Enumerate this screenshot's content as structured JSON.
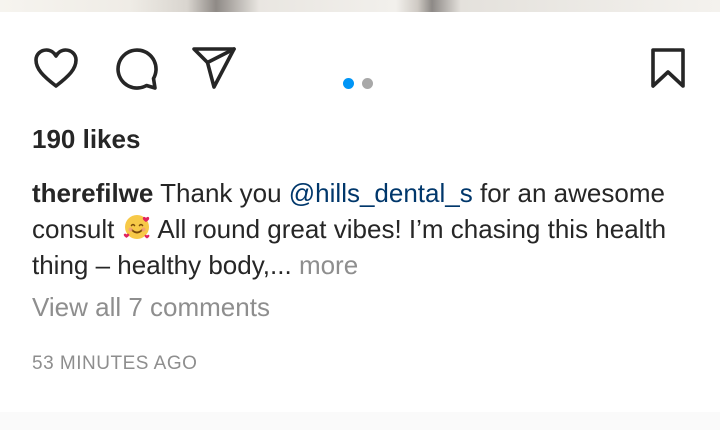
{
  "post": {
    "likes_text": "190 likes",
    "username": "therefilwe",
    "caption_part1": "Thank you",
    "mention": "@hills_dental_s",
    "caption_part2": "for an awesome consult",
    "emoji": "smiling-face-with-hearts",
    "caption_part3": "All round great vibes! I’m chasing this health thing – healthy body,...",
    "more_label": "more",
    "view_comments": "View all 7 comments",
    "timestamp": "53 MINUTES AGO"
  },
  "carousel": {
    "count": 2,
    "active_index": 0
  },
  "icons": [
    "heart-icon",
    "comment-icon",
    "share-icon",
    "bookmark-icon"
  ],
  "colors": {
    "text": "#262626",
    "secondary": "#8e8e8e",
    "mention": "#00376b",
    "active_dot": "#0095f6",
    "inactive_dot": "#a8a8a8"
  }
}
